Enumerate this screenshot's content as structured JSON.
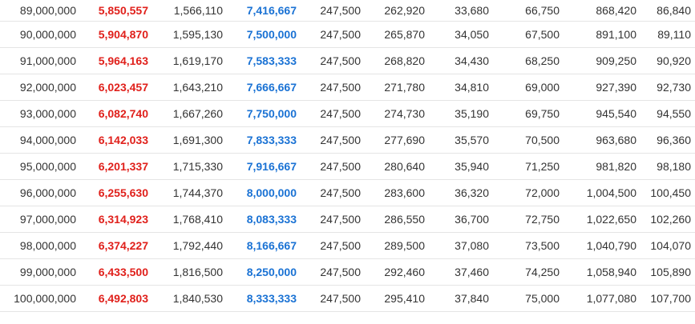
{
  "colors": {
    "net_salary": "#e0201b",
    "monthly_amount": "#1a72d4",
    "text": "#333333",
    "row_border": "#e4e4e4"
  },
  "rows": [
    [
      "89,000,000",
      "5,850,557",
      "1,566,110",
      "7,416,667",
      "247,500",
      "262,920",
      "33,680",
      "66,750",
      "868,420",
      "86,840"
    ],
    [
      "90,000,000",
      "5,904,870",
      "1,595,130",
      "7,500,000",
      "247,500",
      "265,870",
      "34,050",
      "67,500",
      "891,100",
      "89,110"
    ],
    [
      "91,000,000",
      "5,964,163",
      "1,619,170",
      "7,583,333",
      "247,500",
      "268,820",
      "34,430",
      "68,250",
      "909,250",
      "90,920"
    ],
    [
      "92,000,000",
      "6,023,457",
      "1,643,210",
      "7,666,667",
      "247,500",
      "271,780",
      "34,810",
      "69,000",
      "927,390",
      "92,730"
    ],
    [
      "93,000,000",
      "6,082,740",
      "1,667,260",
      "7,750,000",
      "247,500",
      "274,730",
      "35,190",
      "69,750",
      "945,540",
      "94,550"
    ],
    [
      "94,000,000",
      "6,142,033",
      "1,691,300",
      "7,833,333",
      "247,500",
      "277,690",
      "35,570",
      "70,500",
      "963,680",
      "96,360"
    ],
    [
      "95,000,000",
      "6,201,337",
      "1,715,330",
      "7,916,667",
      "247,500",
      "280,640",
      "35,940",
      "71,250",
      "981,820",
      "98,180"
    ],
    [
      "96,000,000",
      "6,255,630",
      "1,744,370",
      "8,000,000",
      "247,500",
      "283,600",
      "36,320",
      "72,000",
      "1,004,500",
      "100,450"
    ],
    [
      "97,000,000",
      "6,314,923",
      "1,768,410",
      "8,083,333",
      "247,500",
      "286,550",
      "36,700",
      "72,750",
      "1,022,650",
      "102,260"
    ],
    [
      "98,000,000",
      "6,374,227",
      "1,792,440",
      "8,166,667",
      "247,500",
      "289,500",
      "37,080",
      "73,500",
      "1,040,790",
      "104,070"
    ],
    [
      "99,000,000",
      "6,433,500",
      "1,816,500",
      "8,250,000",
      "247,500",
      "292,460",
      "37,460",
      "74,250",
      "1,058,940",
      "105,890"
    ],
    [
      "100,000,000",
      "6,492,803",
      "1,840,530",
      "8,333,333",
      "247,500",
      "295,410",
      "37,840",
      "75,000",
      "1,077,080",
      "107,700"
    ]
  ]
}
